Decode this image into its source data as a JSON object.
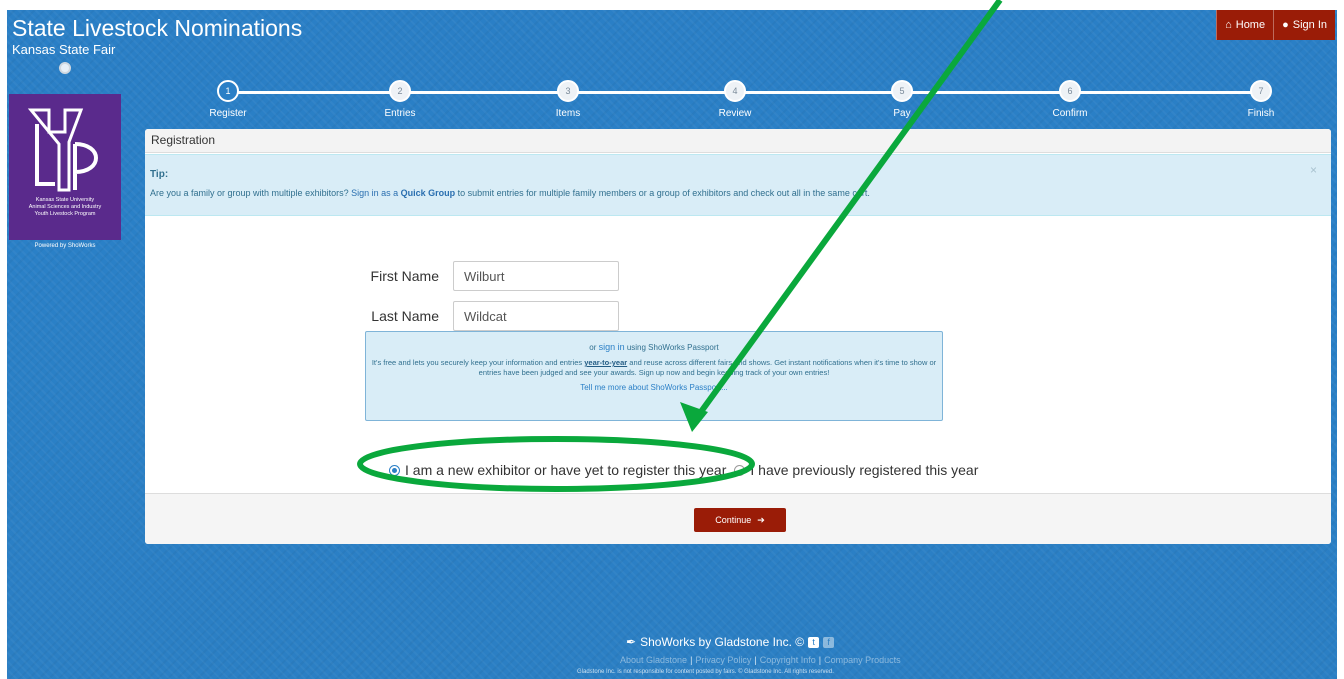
{
  "header": {
    "title": "State Livestock Nominations",
    "subtitle": "Kansas State Fair",
    "home_label": "Home",
    "signin_label": "Sign In"
  },
  "sidebar": {
    "logo_text_line1": "Kansas State University",
    "logo_text_line2": "Animal Sciences and Industry",
    "logo_text_line3": "Youth Livestock Program",
    "powered_by": "Powered by ShoWorks"
  },
  "steps": [
    {
      "num": "1",
      "label": "Register"
    },
    {
      "num": "2",
      "label": "Entries"
    },
    {
      "num": "3",
      "label": "Items"
    },
    {
      "num": "4",
      "label": "Review"
    },
    {
      "num": "5",
      "label": "Pay"
    },
    {
      "num": "6",
      "label": "Confirm"
    },
    {
      "num": "7",
      "label": "Finish"
    }
  ],
  "panel": {
    "heading": "Registration",
    "tip_title": "Tip:",
    "tip_pre": "Are you a family or group with multiple exhibitors? ",
    "tip_signin": "Sign in as a ",
    "tip_quick": "Quick Group",
    "tip_post": " to submit entries for multiple family members or a group of exhibitors and check out all in the same cart.",
    "tip_close": "×"
  },
  "form": {
    "first_name_label": "First Name",
    "first_name_value": "Wilburt",
    "last_name_label": "Last Name",
    "last_name_value": "Wildcat"
  },
  "passport": {
    "or": "or ",
    "sign_in": "sign in",
    "using": " using ShoWorks Passport",
    "body_pre": "It's free and lets you securely keep your information and entries ",
    "body_emph": "year-to-year",
    "body_post": " and reuse across different fairs and shows. Get instant notifications when it's time to show or entries have been judged and see your awards. Sign up now and begin keeping track of your own entries!",
    "more": "Tell me more about ShoWorks Passport..."
  },
  "options": {
    "new_label": "I am a new exhibitor or have yet to register this year",
    "prev_label": "I have previously registered this year",
    "selected": "new"
  },
  "continue_label": "Continue",
  "footer": {
    "brand": "ShoWorks by Gladstone Inc. ©",
    "link1": "About Gladstone",
    "link2": "Privacy Policy",
    "link3": "Copyright Info",
    "link4": "Company Products",
    "copyright": "Gladstone Inc. is not responsible for content posted by fairs. © Gladstone Inc. All rights reserved."
  },
  "colors": {
    "background": "#2a7fc6",
    "brand_button": "#9a1c07",
    "logo_bg": "#5a2a8c",
    "annotation": "#0aa83c"
  },
  "icons": {
    "home": "home-icon",
    "signin": "user-icon",
    "continue": "arrow-right-icon",
    "brand": "feather-icon"
  }
}
